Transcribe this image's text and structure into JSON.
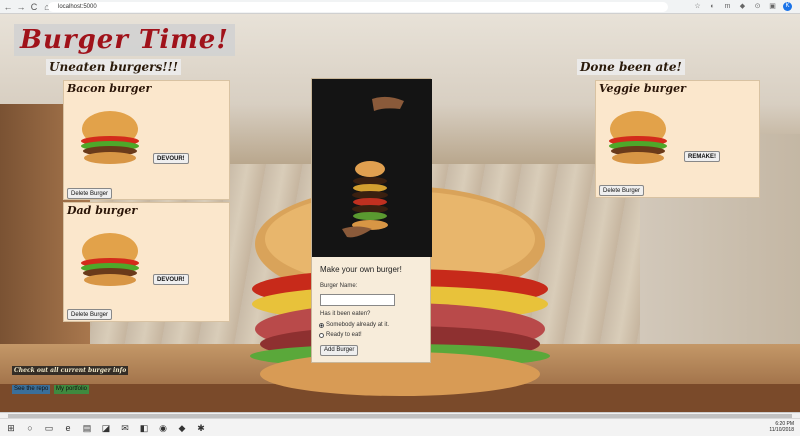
{
  "browser": {
    "url": "localhost:5000",
    "back": "←",
    "forward": "→",
    "reload": "C",
    "home": "⌂"
  },
  "page": {
    "title": "Burger Time!",
    "uneaten_heading": "Uneaten burgers!!!",
    "eaten_heading": "Done been ate!",
    "uneaten": [
      {
        "name": "Bacon burger",
        "action": "DEVOUR!",
        "delete": "Delete Burger"
      },
      {
        "name": "Dad burger",
        "action": "DEVOUR!",
        "delete": "Delete Burger"
      }
    ],
    "eaten": [
      {
        "name": "Veggie burger",
        "action": "REMAKE!",
        "delete": "Delete Burger"
      }
    ],
    "form": {
      "title": "Make your own burger!",
      "name_label": "Burger Name:",
      "name_value": "",
      "eaten_label": "Has it been eaten?",
      "option_yes": "Somebody already at it.",
      "option_no": "Ready to eat!",
      "selected": "yes",
      "submit": "Add Burger"
    },
    "info_link": "Check out all current burger info",
    "repo_link": "See the repo",
    "portfolio_link": "My portfolio"
  },
  "taskbar": {
    "time": "6:20 PM",
    "date": "11/10/2018"
  }
}
